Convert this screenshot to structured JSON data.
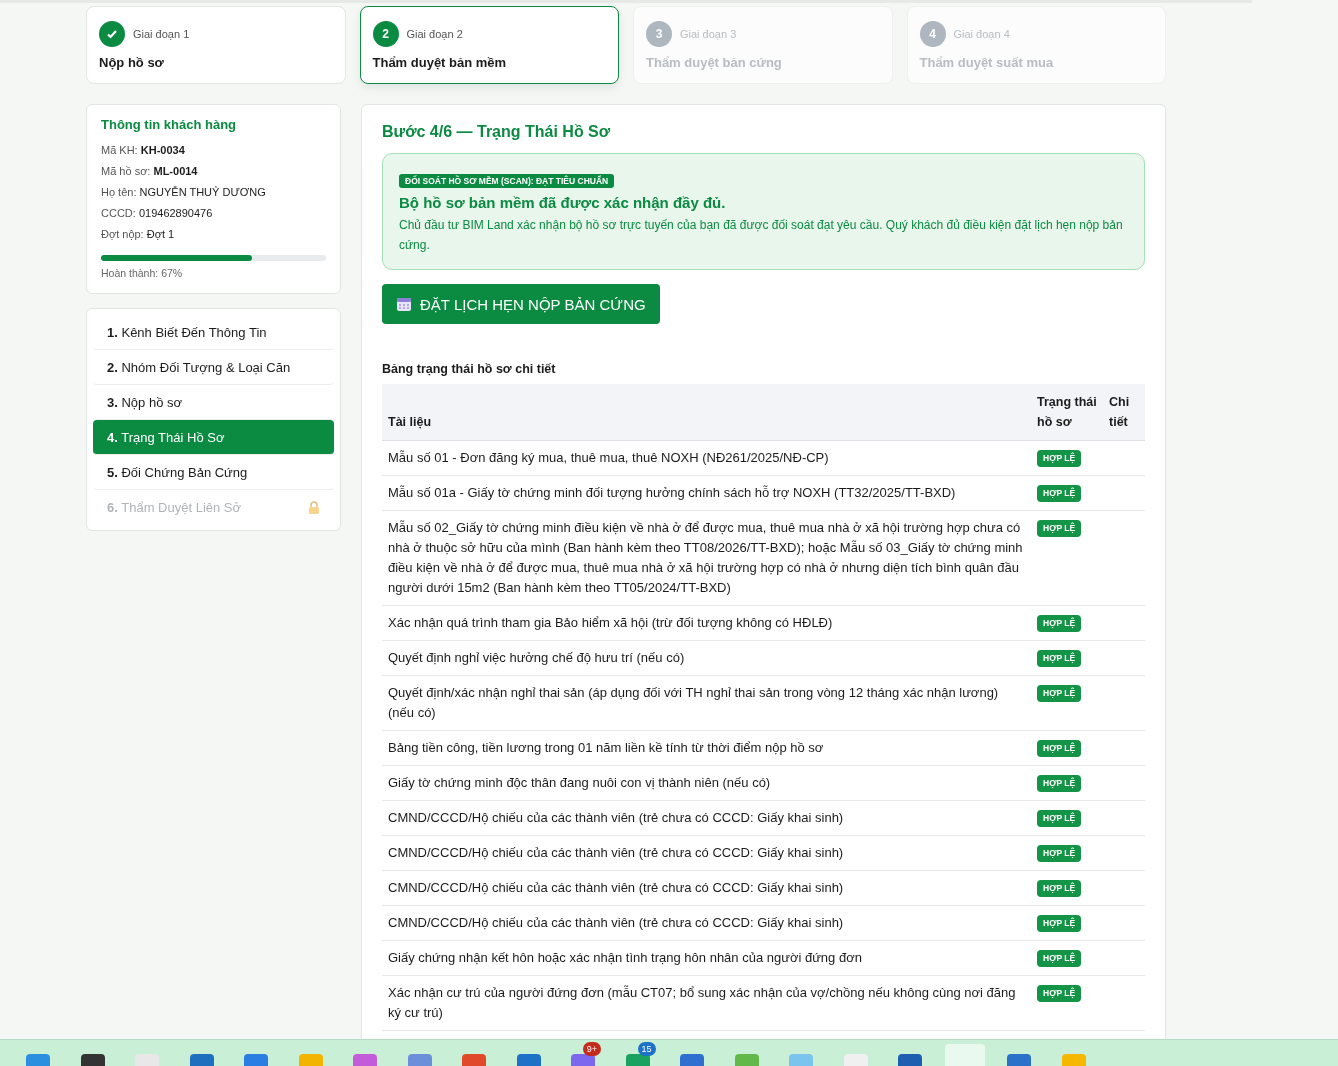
{
  "stages": [
    {
      "caption": "Giai đoạn 1",
      "title": "Nộp hồ sơ",
      "completed": true,
      "selected": false,
      "locked": false
    },
    {
      "number": "2",
      "caption": "Giai đoạn 2",
      "title": "Thẩm duyệt bản mềm",
      "completed": false,
      "selected": true,
      "locked": false
    },
    {
      "number": "3",
      "caption": "Giai đoạn 3",
      "title": "Thẩm duyệt bản cứng",
      "completed": false,
      "selected": false,
      "locked": true
    },
    {
      "number": "4",
      "caption": "Giai đoạn 4",
      "title": "Thẩm duyệt suất mua",
      "completed": false,
      "selected": false,
      "locked": true
    }
  ],
  "customer": {
    "title": "Thông tin khách hàng",
    "fields": [
      {
        "label": "Mã KH:",
        "value": "KH-0034",
        "bold": true
      },
      {
        "label": "Mã hồ sơ:",
        "value": "ML-0014",
        "bold": true
      },
      {
        "label": "Họ tên:",
        "value": "NGUYỄN THUỶ DƯƠNG",
        "bold": false
      },
      {
        "label": "CCCD:",
        "value": "019462890476",
        "bold": false
      },
      {
        "label": "Đợt nộp:",
        "value": "Đợt 1",
        "bold": false
      }
    ],
    "progress": {
      "level": 0.67,
      "caption": "Hoàn thành: 67%"
    }
  },
  "steps": [
    {
      "number": "1.",
      "label": "Kênh Biết Đến Thông Tin",
      "selected": false,
      "locked": false
    },
    {
      "number": "2.",
      "label": "Nhóm Đối Tượng & Loại Căn",
      "selected": false,
      "locked": false
    },
    {
      "number": "3.",
      "label": "Nộp hồ sơ",
      "selected": false,
      "locked": false
    },
    {
      "number": "4.",
      "label": "Trạng Thái Hồ Sơ",
      "selected": true,
      "locked": false
    },
    {
      "number": "5.",
      "label": "Đối Chứng Bản Cứng",
      "selected": false,
      "locked": false
    },
    {
      "number": "6.",
      "label": "Thẩm Duyệt Liên Sở",
      "selected": false,
      "locked": true
    }
  ],
  "main": {
    "title": "Bước 4/6 — Trạng Thái Hồ Sơ",
    "notice": {
      "badge": "ĐỐI SOÁT HỒ SƠ MỀM (SCAN): ĐẠT TIÊU CHUẨN",
      "heading": "Bộ hồ sơ bản mềm đã được xác nhận đầy đủ.",
      "text": "Chủ đầu tư BIM Land xác nhận bộ hồ sơ trực tuyến của bạn đã được đối soát đạt yêu cầu. Quý khách đủ điều kiện đặt lịch hẹn nộp bản cứng."
    },
    "button": "ĐẶT LỊCH HẸN NỘP BẢN CỨNG",
    "table_title": "Bảng trạng thái hồ sơ chi tiết",
    "table": {
      "columns": [
        "Tài liệu",
        "Trạng thái hồ sơ",
        "Chi tiết"
      ],
      "rows": [
        {
          "document": "Mẫu số 01 - Đơn đăng ký mua, thuê mua, thuê NOXH (NĐ261/2025/NĐ-CP)",
          "status": "HỢP LỆ"
        },
        {
          "document": "Mẫu số 01a - Giấy tờ chứng minh đối tượng hưởng chính sách hỗ trợ NOXH (TT32/2025/TT-BXD)",
          "status": "HỢP LỆ"
        },
        {
          "document": "Mẫu số 02_Giấy tờ chứng minh điều kiện về nhà ở để được mua, thuê mua nhà ở xã hội trường hợp chưa có nhà ở thuộc sở hữu của mình (Ban hành kèm theo TT08/2026/TT-BXD); hoặc Mẫu số 03_Giấy tờ chứng minh điều kiện về nhà ở để được mua, thuê mua nhà ở xã hội trường hợp có nhà ở nhưng diện tích bình quân đầu người dưới 15m2 (Ban hành kèm theo TT05/2024/TT-BXD)",
          "status": "HỢP LỆ"
        },
        {
          "document": "Xác nhận quá trình tham gia Bảo hiểm xã hội (trừ đối tượng không có HĐLĐ)",
          "status": "HỢP LỆ"
        },
        {
          "document": "Quyết định nghỉ việc hưởng chế độ hưu trí (nếu có)",
          "status": "HỢP LỆ"
        },
        {
          "document": "Quyết định/xác nhận nghỉ thai sản (áp dụng đối với TH nghỉ thai sản trong vòng 12 tháng xác nhận lương) (nếu có)",
          "status": "HỢP LỆ"
        },
        {
          "document": "Bảng tiền công, tiền lương trong 01 năm liền kề tính từ thời điểm nộp hồ sơ",
          "status": "HỢP LỆ"
        },
        {
          "document": "Giấy tờ chứng minh độc thân đang nuôi con vị thành niên (nếu có)",
          "status": "HỢP LỆ"
        },
        {
          "document": "CMND/CCCD/Hộ chiếu của các thành viên (trẻ chưa có CCCD: Giấy khai sinh)",
          "status": "HỢP LỆ"
        },
        {
          "document": "CMND/CCCD/Hộ chiếu của các thành viên (trẻ chưa có CCCD: Giấy khai sinh)",
          "status": "HỢP LỆ"
        },
        {
          "document": "CMND/CCCD/Hộ chiếu của các thành viên (trẻ chưa có CCCD: Giấy khai sinh)",
          "status": "HỢP LỆ"
        },
        {
          "document": "CMND/CCCD/Hộ chiếu của các thành viên (trẻ chưa có CCCD: Giấy khai sinh)",
          "status": "HỢP LỆ"
        },
        {
          "document": "Giấy chứng nhận kết hôn hoặc xác nhận tình trạng hôn nhân của người đứng đơn",
          "status": "HỢP LỆ"
        },
        {
          "document": "Xác nhận cư trú của người đứng đơn (mẫu CT07; bổ sung xác nhận của vợ/chồng nếu không cùng nơi đăng ký cư trú)",
          "status": "HỢP LỆ"
        }
      ]
    }
  },
  "taskbar": {
    "items": [
      {
        "active": false
      },
      {
        "active": false
      },
      {
        "active": false
      },
      {
        "active": false
      },
      {
        "active": false
      },
      {
        "active": false
      },
      {
        "active": false
      },
      {
        "active": false
      },
      {
        "active": false
      },
      {
        "active": false
      },
      {
        "active": false,
        "badge": "9+"
      },
      {
        "active": false,
        "badge": "15"
      },
      {
        "active": false
      },
      {
        "active": false
      },
      {
        "active": false
      },
      {
        "active": false
      },
      {
        "active": false
      },
      {
        "active": true
      },
      {
        "active": false
      },
      {
        "active": false
      }
    ]
  }
}
